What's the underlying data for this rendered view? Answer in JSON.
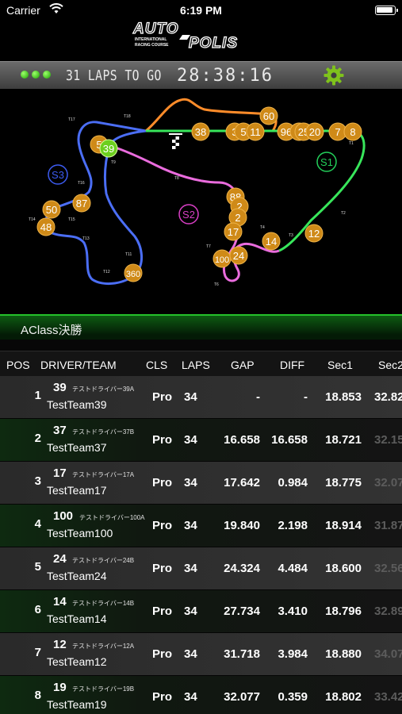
{
  "status": {
    "carrier": "Carrier",
    "time": "6:19 PM"
  },
  "logo": {
    "main": "AUTO POLIS",
    "sub": "INTERNATIONAL RACING COURSE"
  },
  "toolbar": {
    "laps_to_go": "31 LAPS TO GO",
    "remaining": "28:38:16"
  },
  "map": {
    "sectors": [
      {
        "label": "S1",
        "color": "#23d05a"
      },
      {
        "label": "S2",
        "color": "#d93fc5"
      },
      {
        "label": "S3",
        "color": "#3c5bf0"
      }
    ],
    "cars": [
      "60",
      "38",
      "3",
      "5",
      "11",
      "96",
      "2",
      "25",
      "20",
      "7",
      "8",
      "5",
      "39",
      "88",
      "2",
      "2",
      "17",
      "14",
      "12",
      "100",
      "24",
      "87",
      "50",
      "48",
      "360"
    ],
    "leader": "39",
    "corner_labels": [
      "T17",
      "T18",
      "T16",
      "T14",
      "T15",
      "T13",
      "T12",
      "T11",
      "T9",
      "T8",
      "T7",
      "T6",
      "T5",
      "T4",
      "T3",
      "T2",
      "T1"
    ]
  },
  "class_name": "AClass決勝",
  "columns": {
    "pos": "POS",
    "driver": "DRIVER/TEAM",
    "cls": "CLS",
    "laps": "LAPS",
    "gap": "GAP",
    "diff": "DIFF",
    "sec1": "Sec1",
    "sec2": "Sec2"
  },
  "rows": [
    {
      "pos": "1",
      "num": "39",
      "driver": "テストドライバー39A",
      "team": "TestTeam39",
      "cls": "Pro",
      "laps": "34",
      "gap": "-",
      "diff": "-",
      "sec1": "18.853",
      "sec2": "32.82",
      "sec2_dim": false
    },
    {
      "pos": "2",
      "num": "37",
      "driver": "テストドライバー37B",
      "team": "TestTeam37",
      "cls": "Pro",
      "laps": "34",
      "gap": "16.658",
      "diff": "16.658",
      "sec1": "18.721",
      "sec2": "32.15",
      "sec2_dim": true
    },
    {
      "pos": "3",
      "num": "17",
      "driver": "テストドライバー17A",
      "team": "TestTeam17",
      "cls": "Pro",
      "laps": "34",
      "gap": "17.642",
      "diff": "0.984",
      "sec1": "18.775",
      "sec2": "32.07",
      "sec2_dim": true
    },
    {
      "pos": "4",
      "num": "100",
      "driver": "テストドライバー100A",
      "team": "TestTeam100",
      "cls": "Pro",
      "laps": "34",
      "gap": "19.840",
      "diff": "2.198",
      "sec1": "18.914",
      "sec2": "31.87",
      "sec2_dim": true
    },
    {
      "pos": "5",
      "num": "24",
      "driver": "テストドライバー24B",
      "team": "TestTeam24",
      "cls": "Pro",
      "laps": "34",
      "gap": "24.324",
      "diff": "4.484",
      "sec1": "18.600",
      "sec2": "32.56",
      "sec2_dim": true
    },
    {
      "pos": "6",
      "num": "14",
      "driver": "テストドライバー14B",
      "team": "TestTeam14",
      "cls": "Pro",
      "laps": "34",
      "gap": "27.734",
      "diff": "3.410",
      "sec1": "18.796",
      "sec2": "32.89",
      "sec2_dim": true
    },
    {
      "pos": "7",
      "num": "12",
      "driver": "テストドライバー12A",
      "team": "TestTeam12",
      "cls": "Pro",
      "laps": "34",
      "gap": "31.718",
      "diff": "3.984",
      "sec1": "18.880",
      "sec2": "34.07",
      "sec2_dim": true
    },
    {
      "pos": "8",
      "num": "19",
      "driver": "テストドライバー19B",
      "team": "TestTeam19",
      "cls": "Pro",
      "laps": "34",
      "gap": "32.077",
      "diff": "0.359",
      "sec1": "18.802",
      "sec2": "33.42",
      "sec2_dim": true
    }
  ]
}
